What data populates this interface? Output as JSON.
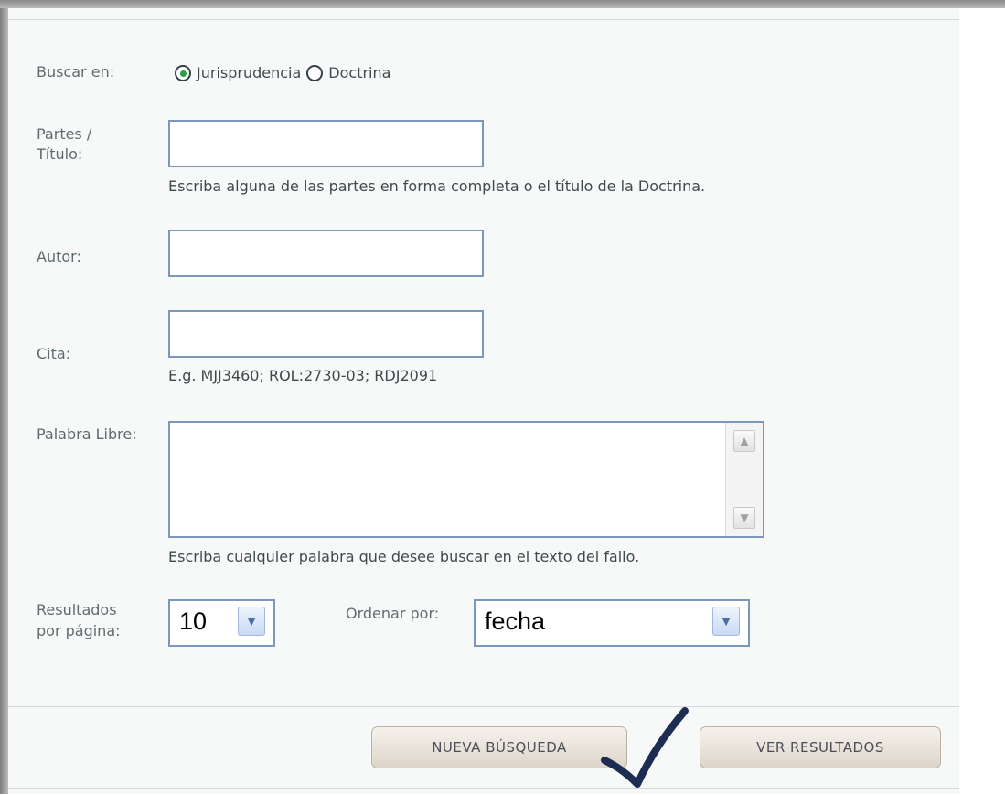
{
  "search_in": {
    "label": "Buscar en:",
    "options": [
      {
        "label": "Jurisprudencia",
        "checked": true
      },
      {
        "label": "Doctrina",
        "checked": false
      }
    ]
  },
  "fields": {
    "partes_label_1": "Partes /",
    "partes_label_2": "Título:",
    "partes_value": "",
    "partes_hint": "Escriba alguna de las partes en forma completa o el título de la Doctrina.",
    "autor_label": "Autor:",
    "autor_value": "",
    "cita_label": "Cita:",
    "cita_value": "",
    "cita_hint": "E.g. MJJ3460; ROL:2730-03; RDJ2091",
    "palabra_label": "Palabra Libre:",
    "palabra_value": "",
    "palabra_hint": "Escriba cualquier palabra que desee buscar en el texto del fallo."
  },
  "results": {
    "label_1": "Resultados",
    "label_2": "por página:",
    "value": "10"
  },
  "order": {
    "label": "Ordenar por:",
    "value": "fecha"
  },
  "buttons": {
    "new_search": "NUEVA BÚSQUEDA",
    "view_results": "VER RESULTADOS"
  },
  "colors": {
    "field_border": "#7b97b9",
    "checkmark": "#1d2d52",
    "radio_dot": "#2f9a4a"
  },
  "icons": {
    "scroll_up": "chevron-up-icon",
    "scroll_down": "chevron-down-icon",
    "annotation": "checkmark-icon"
  }
}
